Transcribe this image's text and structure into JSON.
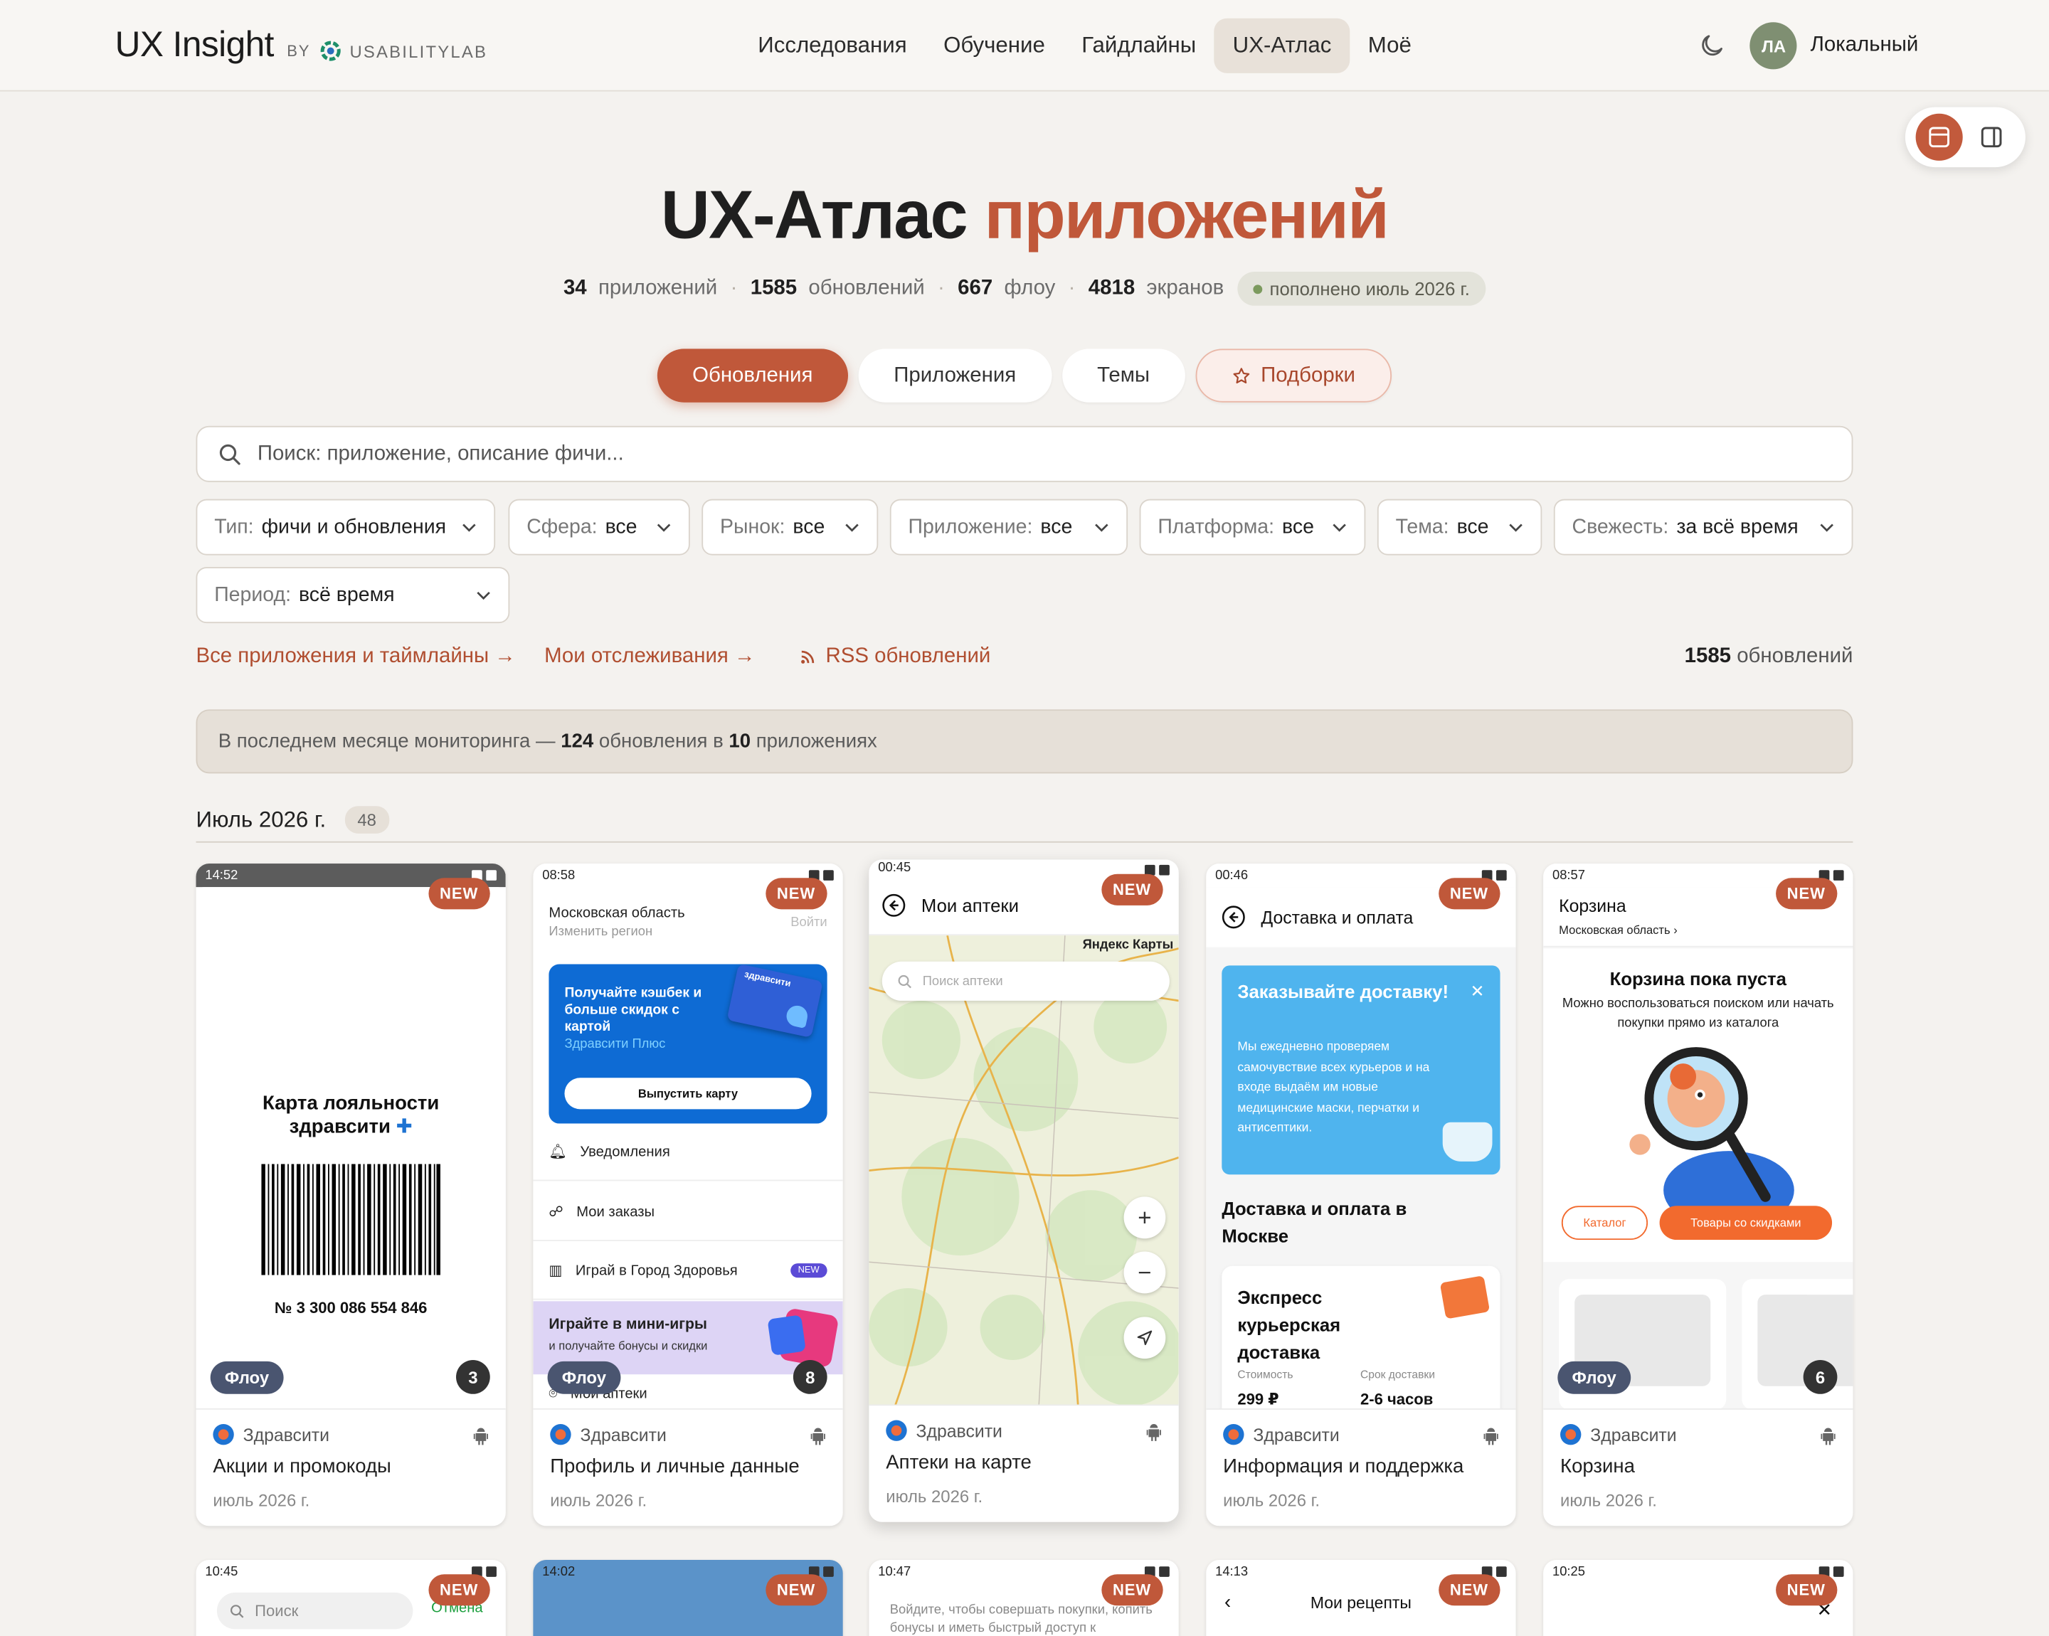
{
  "header": {
    "brand": "UX Insight",
    "by": "BY",
    "lab": "USABILITYLAB",
    "nav": [
      "Исследования",
      "Обучение",
      "Гайдлайны",
      "UX-Атлас",
      "Моё"
    ],
    "avatar": "ЛА",
    "user": "Локальный"
  },
  "hero": {
    "title_plain": "UX-Атлас",
    "title_accent": "приложений",
    "stats": {
      "apps_n": "34",
      "apps_l": "приложений",
      "updates_n": "1585",
      "updates_l": "обновлений",
      "flows_n": "667",
      "flows_l": "флоу",
      "screens_n": "4818",
      "screens_l": "экранов",
      "fresh": "пополнено июль 2026 г."
    }
  },
  "tabs": [
    "Обновления",
    "Приложения",
    "Темы",
    "Подборки"
  ],
  "search": {
    "placeholder": "Поиск: приложение, описание фичи..."
  },
  "filters": [
    {
      "label": "Тип:",
      "value": "фичи и обновления"
    },
    {
      "label": "Сфера:",
      "value": "все"
    },
    {
      "label": "Рынок:",
      "value": "все"
    },
    {
      "label": "Приложение:",
      "value": "все"
    },
    {
      "label": "Платформа:",
      "value": "все"
    },
    {
      "label": "Тема:",
      "value": "все"
    },
    {
      "label": "Свежесть:",
      "value": "за всё время"
    },
    {
      "label": "Период:",
      "value": "всё время"
    }
  ],
  "links": {
    "all_apps": "Все приложения и таймлайны →",
    "my_tracking": "Мои отслеживания →",
    "rss": "RSS обновлений",
    "total_n": "1585",
    "total_l": "обновлений"
  },
  "banner": {
    "pre": "В последнем месяце мониторинга —",
    "n_updates": "124",
    "mid": "обновления в",
    "n_apps": "10",
    "post": "приложениях"
  },
  "month": {
    "title": "Июль 2026 г.",
    "count": "48"
  },
  "colors": {
    "accent": "#c0583a",
    "flow_badge": "#4a5570",
    "bg": "#f4f2ef"
  },
  "cards": [
    {
      "app": "Здравсити",
      "title": "Акции и промокоды",
      "date": "июль 2026 г.",
      "new": "NEW",
      "flow": "Флоу",
      "count": "3",
      "time": "14:52",
      "content": {
        "heading1": "Карта лояльности",
        "heading2": "здравсити",
        "card_no": "№ 3 300 086 554 846"
      }
    },
    {
      "app": "Здравсити",
      "title": "Профиль и личные данные",
      "date": "июль 2026 г.",
      "new": "NEW",
      "flow": "Флоу",
      "count": "8",
      "time": "08:58",
      "content": {
        "region": "Московская область",
        "region_sub": "Изменить регион",
        "login": "Войти",
        "promo": "Получайте кэшбек и больше скидок с картой",
        "promo_brand": "Здравсити Плюс",
        "promo_btn": "Выпустить карту",
        "card_word": "здравсити",
        "item1": "Уведомления",
        "item2": "Мои заказы",
        "item3": "Играй в Город Здоровья",
        "item3_badge": "NEW",
        "game_title": "Играйте в мини-игры",
        "game_sub": "и получайте бонусы и скидки",
        "item4": "Мои аптеки"
      }
    },
    {
      "app": "Здравсити",
      "title": "Аптеки на карте",
      "date": "июль 2026 г.",
      "new": "NEW",
      "time": "00:45",
      "content": {
        "header": "Мои аптеки",
        "search": "Поиск аптеки",
        "maps": "Яндекс Карты"
      }
    },
    {
      "app": "Здравсити",
      "title": "Информация и поддержка",
      "date": "июль 2026 г.",
      "new": "NEW",
      "time": "00:46",
      "content": {
        "header": "Доставка и оплата",
        "promo_title": "Заказывайте доставку!",
        "promo_text": "Мы ежедневно проверяем самочувствие всех курьеров и на входе выдаём им новые медицинские маски, перчатки и антисептики.",
        "section": "Доставка и оплата в Москве",
        "express": "Экспресс курьерская доставка",
        "cost_l": "Стоимость",
        "cost_v": "299 ₽",
        "term_l": "Срок доставки",
        "term_v": "2-6 часов"
      }
    },
    {
      "app": "Здравсити",
      "title": "Корзина",
      "date": "июль 2026 г.",
      "new": "NEW",
      "flow": "Флоу",
      "count": "6",
      "time": "08:57",
      "content": {
        "header": "Корзина",
        "region": "Московская область",
        "empty": "Корзина пока пуста",
        "empty_sub": "Можно воспользоваться поиском или начать покупки прямо из каталога",
        "btn1": "Каталог",
        "btn2": "Товары со скидками"
      }
    }
  ],
  "row2": [
    {
      "time": "10:45",
      "new": "NEW",
      "search": "Поиск",
      "cancel": "Отмена"
    },
    {
      "time": "14:02",
      "new": "NEW"
    },
    {
      "time": "10:47",
      "new": "NEW",
      "text": "Войдите, чтобы совершать покупки, копить бонусы и иметь быстрый доступ к"
    },
    {
      "time": "14:13",
      "new": "NEW",
      "header": "Мои рецепты"
    },
    {
      "time": "10:25",
      "new": "NEW"
    }
  ]
}
